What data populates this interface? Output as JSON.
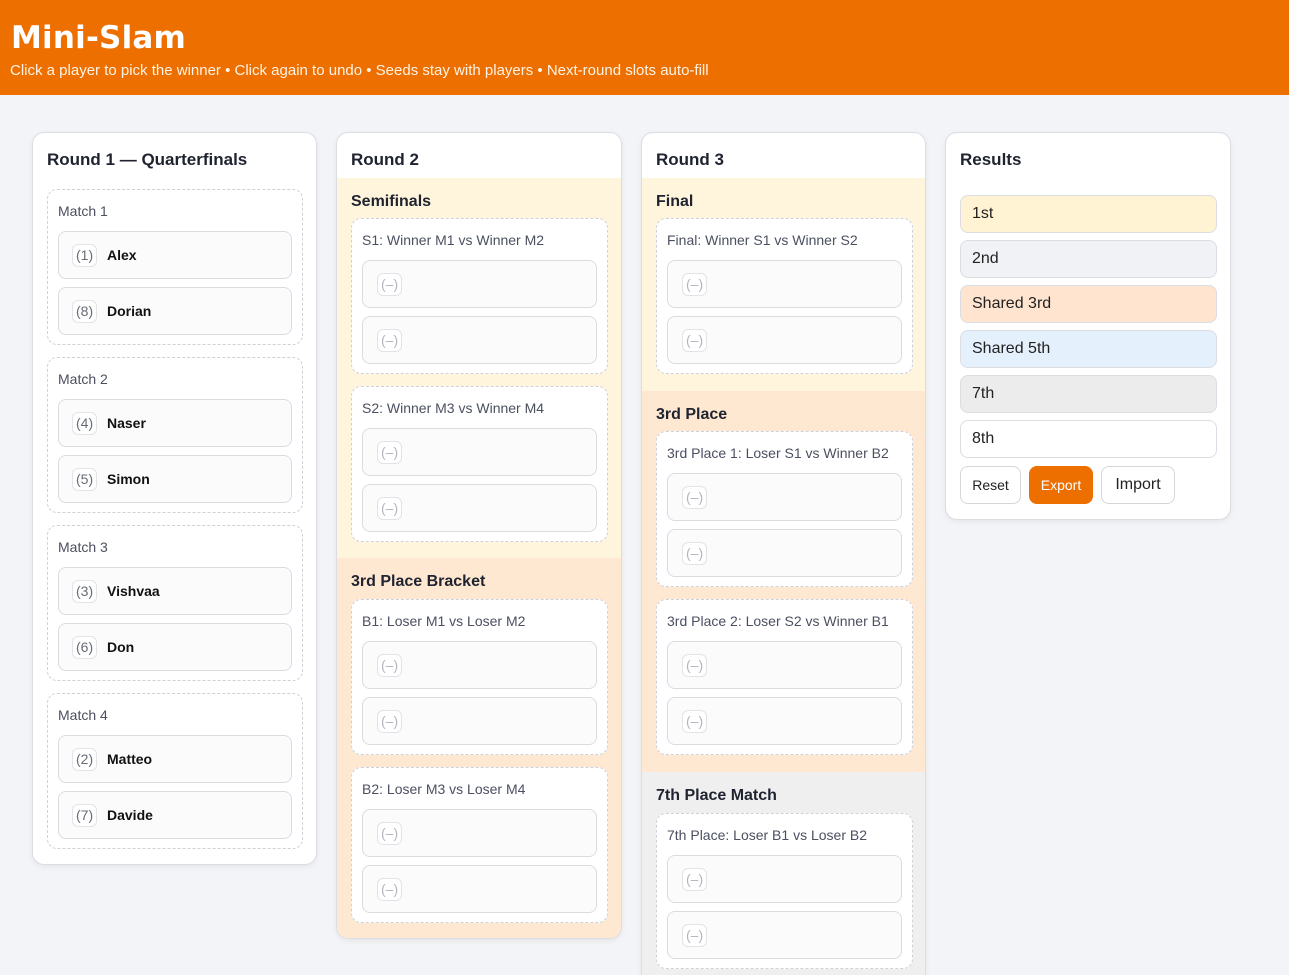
{
  "header": {
    "title": "Mini-Slam",
    "subtitle": "Click a player to pick the winner • Click again to undo • Seeds stay with players • Next-round slots auto-fill"
  },
  "round1": {
    "title": "Round 1 — Quarterfinals",
    "matches": [
      {
        "label": "Match 1",
        "players": [
          {
            "seed": "(1)",
            "name": "Alex"
          },
          {
            "seed": "(8)",
            "name": "Dorian"
          }
        ]
      },
      {
        "label": "Match 2",
        "players": [
          {
            "seed": "(4)",
            "name": "Naser"
          },
          {
            "seed": "(5)",
            "name": "Simon"
          }
        ]
      },
      {
        "label": "Match 3",
        "players": [
          {
            "seed": "(3)",
            "name": "Vishvaa"
          },
          {
            "seed": "(6)",
            "name": "Don"
          }
        ]
      },
      {
        "label": "Match 4",
        "players": [
          {
            "seed": "(2)",
            "name": "Matteo"
          },
          {
            "seed": "(7)",
            "name": "Davide"
          }
        ]
      }
    ]
  },
  "round2": {
    "title": "Round 2",
    "semifinals_title": "Semifinals",
    "third_bracket_title": "3rd Place Bracket",
    "matches": [
      {
        "label": "S1: Winner M1 vs Winner M2",
        "slots": [
          "(–)",
          "(–)"
        ]
      },
      {
        "label": "S2: Winner M3 vs Winner M4",
        "slots": [
          "(–)",
          "(–)"
        ]
      },
      {
        "label": "B1: Loser M1 vs Loser M2",
        "slots": [
          "(–)",
          "(–)"
        ]
      },
      {
        "label": "B2: Loser M3 vs Loser M4",
        "slots": [
          "(–)",
          "(–)"
        ]
      }
    ]
  },
  "round3": {
    "title": "Round 3",
    "final_title": "Final",
    "third_place_title": "3rd Place",
    "seventh_title": "7th Place Match",
    "matches": [
      {
        "label": "Final: Winner S1 vs Winner S2",
        "slots": [
          "(–)",
          "(–)"
        ]
      },
      {
        "label": "3rd Place 1: Loser S1 vs Winner B2",
        "slots": [
          "(–)",
          "(–)"
        ]
      },
      {
        "label": "3rd Place 2: Loser S2 vs Winner B1",
        "slots": [
          "(–)",
          "(–)"
        ]
      },
      {
        "label": "7th Place: Loser B1 vs Loser B2",
        "slots": [
          "(–)",
          "(–)"
        ]
      }
    ]
  },
  "results": {
    "title": "Results",
    "places": [
      "1st",
      "2nd",
      "Shared 3rd",
      "Shared 5th",
      "7th",
      "8th"
    ],
    "buttons": {
      "reset": "Reset",
      "export": "Export",
      "import": "Import"
    }
  },
  "colors": {
    "brand": "#ec6f00",
    "semifinals_bg": "#fff5dc",
    "third_bg": "#ffe8d1",
    "seventh_bg": "#efefef",
    "first_bg": "#fff3d4",
    "second_bg": "#f1f2f5",
    "third_result_bg": "#ffe5cf",
    "fifth_bg": "#e5f0fd",
    "seventh_result_bg": "#ececec"
  }
}
